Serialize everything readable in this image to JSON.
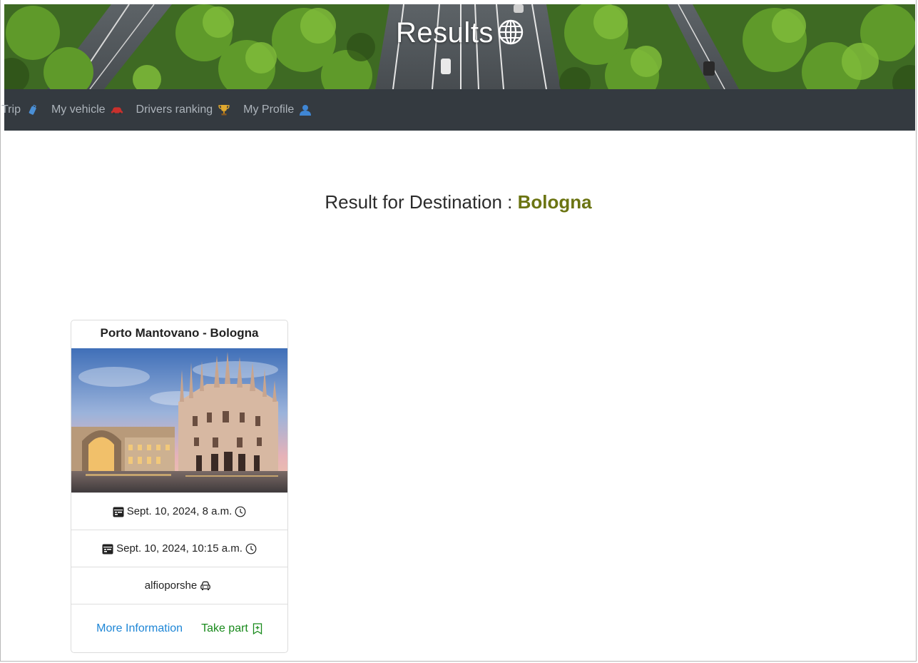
{
  "hero": {
    "title": "Results"
  },
  "nav": {
    "items": [
      {
        "label": "Trip",
        "icon": "luggage-icon"
      },
      {
        "label": "My vehicle",
        "icon": "car-icon"
      },
      {
        "label": "Drivers ranking",
        "icon": "trophy-icon"
      },
      {
        "label": "My Profile",
        "icon": "person-icon"
      }
    ]
  },
  "heading": {
    "prefix": "Result for Destination :",
    "destination": "Bologna"
  },
  "trip_card": {
    "title": "Porto Mantovano - Bologna",
    "image": "milan-cathedral-photo",
    "departure": "Sept. 10, 2024, 8 a.m.",
    "arrival": "Sept. 10, 2024, 10:15 a.m.",
    "driver": "alfioporshe",
    "more_label": "More Information",
    "take_part_label": "Take part"
  },
  "colors": {
    "navbar_bg": "#343a40",
    "nav_text": "#adb4bb",
    "destination_accent": "#6b7412",
    "link_blue": "#1e86d6",
    "link_green": "#198a1c"
  }
}
